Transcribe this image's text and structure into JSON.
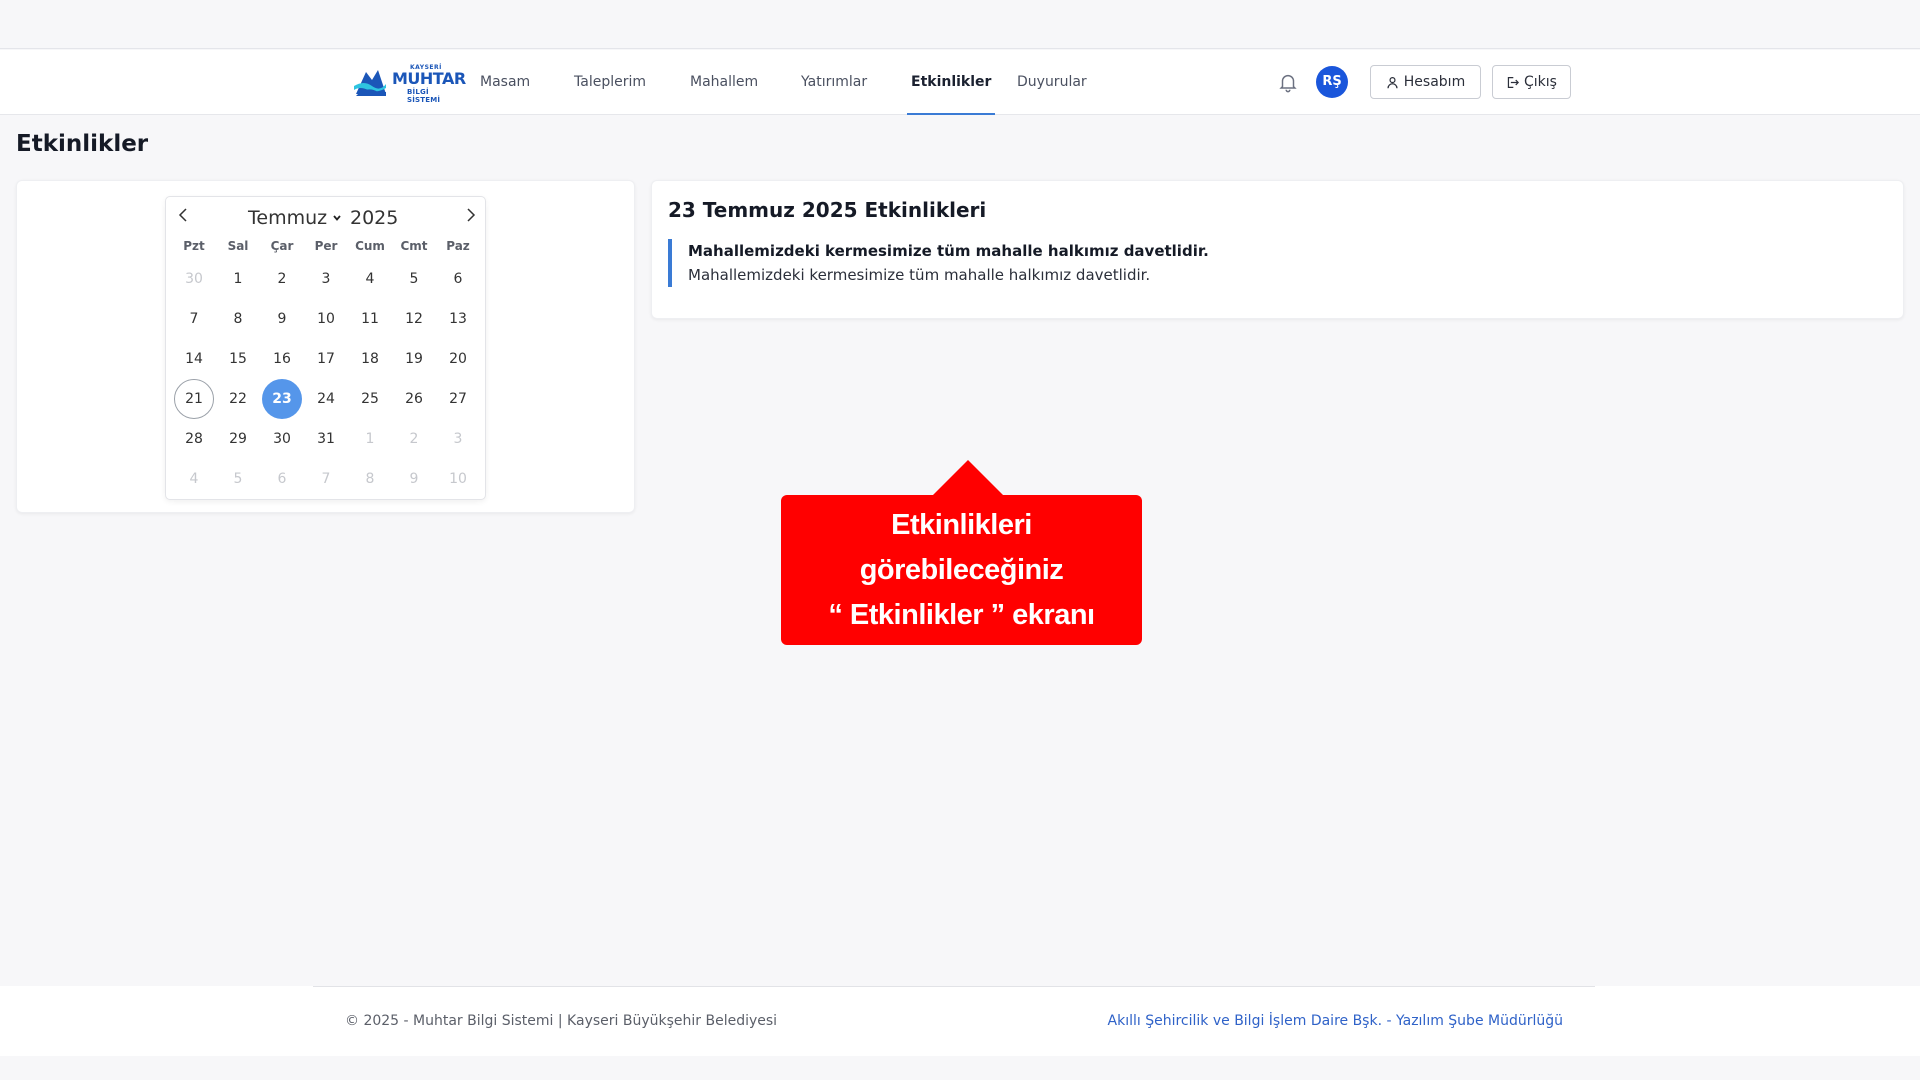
{
  "header": {
    "logo": {
      "small": "KAYSERİ",
      "main": "MUHTAR",
      "sub": "BİLGİ SİSTEMİ"
    },
    "nav": [
      {
        "label": "Masam",
        "active": false
      },
      {
        "label": "Taleplerim",
        "active": false
      },
      {
        "label": "Mahallem",
        "active": false
      },
      {
        "label": "Yatırımlar",
        "active": false
      },
      {
        "label": "Etkinlikler",
        "active": true
      },
      {
        "label": "Duyurular",
        "active": false
      }
    ],
    "avatar_initials": "RŞ",
    "account_label": "Hesabım",
    "logout_label": "Çıkış"
  },
  "page": {
    "title": "Etkinlikler"
  },
  "calendar": {
    "month": "Temmuz",
    "year": "2025",
    "weekdays": [
      "Pzt",
      "Sal",
      "Çar",
      "Per",
      "Cum",
      "Cmt",
      "Paz"
    ],
    "weeks": [
      [
        "30",
        "1",
        "2",
        "3",
        "4",
        "5",
        "6"
      ],
      [
        "7",
        "8",
        "9",
        "10",
        "11",
        "12",
        "13"
      ],
      [
        "14",
        "15",
        "16",
        "17",
        "18",
        "19",
        "20"
      ],
      [
        "21",
        "22",
        "23",
        "24",
        "25",
        "26",
        "27"
      ],
      [
        "28",
        "29",
        "30",
        "31",
        "1",
        "2",
        "3"
      ],
      [
        "4",
        "5",
        "6",
        "7",
        "8",
        "9",
        "10"
      ]
    ],
    "today": "21",
    "selected": "23"
  },
  "events_panel": {
    "title": "23 Temmuz 2025 Etkinlikleri",
    "events": [
      {
        "title": "Mahallemizdeki kermesimize tüm mahalle halkımız davetlidir.",
        "description": "Mahallemizdeki kermesimize tüm mahalle halkımız davetlidir."
      }
    ]
  },
  "callout": {
    "lines": [
      "Etkinlikleri",
      "görebileceğiniz",
      "“ Etkinlikler ” ekranı"
    ],
    "color": "#ff0000"
  },
  "footer": {
    "copyright": "© 2025 - Muhtar Bilgi Sistemi | Kayseri Büyükşehir Belediyesi",
    "link": "Akıllı Şehircilik ve Bilgi İşlem Daire Bşk. - Yazılım Şube Müdürlüğü"
  },
  "colors": {
    "accent": "#3a7bd5",
    "avatar": "#1a56db",
    "selected_day": "#5596ea"
  }
}
